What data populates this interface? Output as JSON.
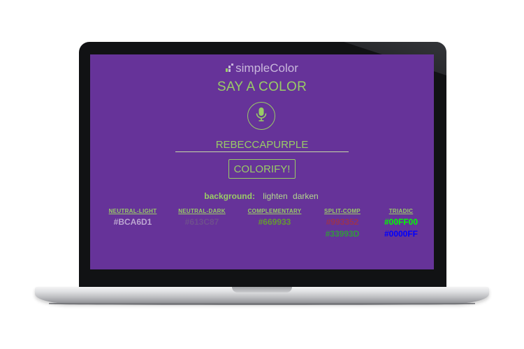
{
  "theme": {
    "background": "#663399",
    "foreground": "#99CC66"
  },
  "app": {
    "brand": "simpleColor",
    "headline": "SAY A COLOR",
    "color_input": "REBECCAPURPLE",
    "submit_label": "COLORIFY!",
    "background": {
      "label": "background:",
      "lighten_label": "lighten",
      "darken_label": "darken"
    },
    "palettes": [
      {
        "label": "NEUTRAL-LIGHT",
        "values": [
          "#BCA6D1"
        ],
        "colors": [
          "#BCA6D1"
        ]
      },
      {
        "label": "NEUTRAL-DARK",
        "values": [
          "#613C87"
        ],
        "colors": [
          "#6e4f8d"
        ]
      },
      {
        "label": "COMPLEMENTARY",
        "values": [
          "#669933"
        ],
        "colors": [
          "#669933"
        ]
      },
      {
        "label": "SPLIT-COMP",
        "values": [
          "#993352",
          "#33993D"
        ],
        "colors": [
          "#993352",
          "#33993D"
        ]
      },
      {
        "label": "TRIADIC",
        "values": [
          "#00FF00",
          "#0000FF"
        ],
        "colors": [
          "#00FF00",
          "#0000FF"
        ]
      }
    ]
  },
  "icons": {
    "logo": "bars-logo-icon",
    "mic": "microphone-icon"
  }
}
